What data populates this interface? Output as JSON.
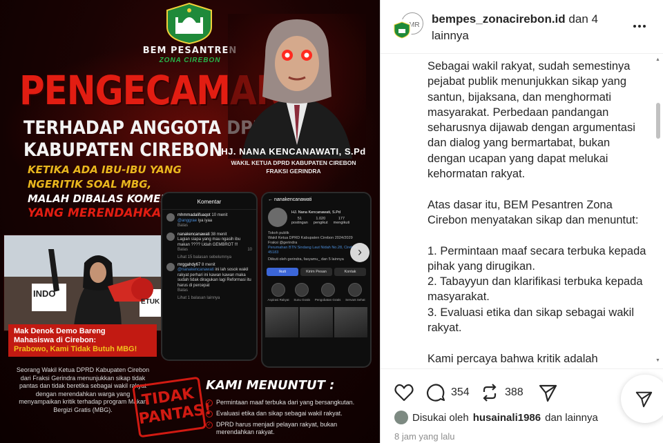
{
  "poster": {
    "org_name": "BEM PESANTREN",
    "org_sub": "ZONA CIREBON",
    "headline": "PENGECAMAN",
    "sub_line1": "TERHADAP ANGGOTA DPRD",
    "sub_line2": "KABUPATEN CIREBON",
    "tagline_line1": "KETIKA ADA IBU-IBU YANG",
    "tagline_line2": "NGERITIK SOAL MBG,",
    "tagline_line3": "MALAH DIBALAS KOMEN",
    "tagline_line4": "YANG MERENDAHKAN!",
    "person_name": "HJ. NANA KENCANAWATI, S.Pd",
    "person_title": "WAKIL KETUA DPRD KABUPATEN CIREBON",
    "person_faction": "FRAKSI GERINDRA",
    "photo_sign_left": "INDO",
    "photo_sign_right": "ETUK",
    "photo_caption1": "Mak Denok Demo Bareng",
    "photo_caption2": "Mahasiswa di Cirebon:",
    "photo_caption3": "Prabowo, Kami Tidak Butuh MBG!",
    "body_text": "Seorang Wakil Ketua DPRD Kabupaten Cirebon dari Fraksi Gerindra menunjukkan sikap tidak pantas dan tidak beretika sebagai wakil rakyat dengan merendahkan warga yang menyampaikan kritik terhadap program Makan Bergizi Gratis (MBG).",
    "phone1": {
      "header": "Komentar",
      "c1_user": "mhmmadalifuaqot",
      "c1_time": "10 menit",
      "c1_mention": "@anggrae",
      "c1_text": "iya iyaa",
      "c1_reply": "Balas",
      "c2_user": "nanakencanawati",
      "c2_time": "38 menit",
      "c2_text": "Lagian siapa yang mau ngasih ibu makan ???? Udah GEMBROT !!!",
      "c2_reply": "Balas",
      "c2_count": "10",
      "more1": "Lihat 15 balasan sebelumnya",
      "c3_user": "mrggahdy67",
      "c3_time": "8 menit",
      "c3_mention": "@nanakencanawati",
      "c3_text": "ini lah sosok wakil rakyat perhari ini kawan kawan maka sudah tidak diragukan lagi Reformasi itu harus di percepat",
      "c3_reply": "Balas",
      "more2": "Lihat 1 balasan lainnya"
    },
    "phone2": {
      "username": "nanakencanawati",
      "display_name": "HJ. Nana Kencanawati, S.Pd",
      "posts": "51",
      "posts_label": "postingan",
      "followers": "1.020",
      "followers_label": "pengikut",
      "following": "177",
      "following_label": "mengikuti",
      "bio1": "Tokoh publik",
      "bio2": "Wakil Ketua DPRD Kabupaten Cirebon 2024/2029",
      "bio3": "Fraksi @gerindra",
      "bio4": "Perumahan BTN Sindang Laut Nidah No.28, Cirebon 45183",
      "followed_by": "Diikuti oleh gerindra, fasyamu_ dan 5 lainnya",
      "btn_follow": "Ikuti",
      "btn_message": "Kirim Pesan",
      "btn_contact": "Kontak",
      "h1": "Aspirasi Rakyat",
      "h2": "Sunu Gratis",
      "h3": "Pengobatan Gratis",
      "h4": "Servant Sehat"
    },
    "stamp": "TIDAK PANTAS!",
    "stamp_line1": "TIDAK",
    "stamp_line2": "PANTAS!",
    "demands_title": "KAMI MENUNTUT :",
    "demands": [
      "Permintaan maaf terbuka dari yang bersangkutan.",
      "Evaluasi etika dan sikap sebagai wakil rakyat.",
      "DPRD harus menjadi pelayan rakyat, bukan merendahkan rakyat."
    ]
  },
  "post": {
    "account": "bempes_zonacirebon.id",
    "account_suffix": "dan 4",
    "account_suffix2": "lainnya",
    "caption_paragraphs": [
      "Sebagai wakil rakyat, sudah semestinya pejabat publik menunjukkan sikap yang santun, bijaksana, dan menghormati masyarakat. Perbedaan pandangan seharusnya dijawab dengan argumentasi dan dialog yang bermartabat, bukan dengan ucapan yang dapat melukai kehormatan rakyat.",
      "Atas dasar itu, BEM Pesantren Zona Cirebon menyatakan sikap dan menuntut:",
      "1.  Permintaan maaf secara terbuka kepada pihak yang dirugikan.\n2. Tabayyun dan klarifikasi terbuka kepada masyarakat.\n3. Evaluasi etika dan sikap sebagai wakil rakyat.",
      "Kami percaya bahwa kritik adalah"
    ],
    "comments_count": "354",
    "reposts_count": "388",
    "liked_by_prefix": "Disukai oleh",
    "liked_by_user": "husainali1986",
    "liked_by_suffix": "dan lainnya",
    "time_ago": "8 jam yang lalu"
  },
  "colors": {
    "accent_red": "#e21d12",
    "accent_yellow": "#e9b71e",
    "ig_text": "#262626",
    "ig_muted": "#8e8e8e"
  },
  "icons": [
    "emblem-icon",
    "more-icon",
    "heart-icon",
    "comment-icon",
    "repost-icon",
    "send-icon",
    "share-icon",
    "chevron-right-icon"
  ]
}
